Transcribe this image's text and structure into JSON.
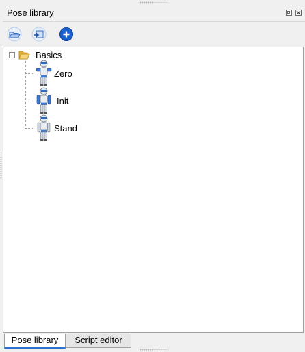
{
  "panel": {
    "title": "Pose library",
    "title_buttons": [
      "float-icon",
      "close-icon"
    ]
  },
  "toolbar": {
    "items": [
      {
        "icon": "open-folder-icon",
        "label": ""
      },
      {
        "icon": "import-icon",
        "label": ""
      },
      {
        "icon": "add-icon",
        "label": ""
      }
    ]
  },
  "tree": {
    "folder": {
      "label": "Basics",
      "expanded": true,
      "icon": "folder-icon",
      "children": [
        {
          "label": "Zero",
          "icon": "robot-pose-icon"
        },
        {
          "label": "Init",
          "icon": "robot-pose-icon"
        },
        {
          "label": "Stand",
          "icon": "robot-pose-icon"
        }
      ]
    }
  },
  "tabs": [
    {
      "label": "Pose library",
      "active": true
    },
    {
      "label": "Script editor",
      "active": false
    }
  ],
  "colors": {
    "accent": "#2d6fd0",
    "add_button": "#1a5fd0",
    "folder": "#f2c94c"
  }
}
